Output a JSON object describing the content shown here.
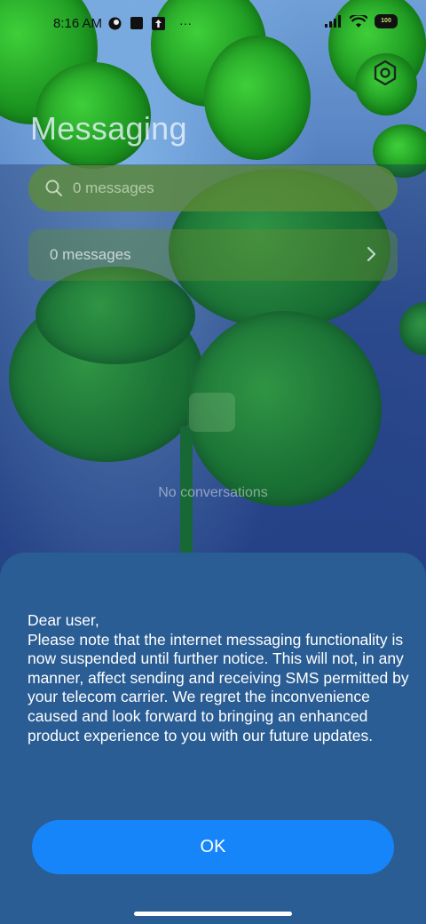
{
  "status_bar": {
    "time": "8:16 AM",
    "more_glyph": "···",
    "battery_level": "100",
    "icons": [
      "notification-icon",
      "app-icon",
      "upload-icon",
      "signal-icon",
      "wifi-icon",
      "battery-icon"
    ]
  },
  "header": {
    "title": "Messaging",
    "settings_icon": "settings-icon"
  },
  "search": {
    "placeholder": "0 messages"
  },
  "messages_row": {
    "label": "0 messages"
  },
  "empty_state": {
    "text": "No conversations"
  },
  "dialog": {
    "message": "Dear user,\nPlease note that the internet messaging functionality is now suspended until further notice. This will not, in any manner, affect sending and receiving SMS permitted by your telecom carrier. We regret the inconvenience caused and look forward to bringing an enhanced product experience to you with our future updates.",
    "ok_label": "OK"
  },
  "colors": {
    "sheet_bg": "#2a5d94",
    "ok_button_bg": "#1685f9",
    "search_bg": "#5f8c37"
  }
}
